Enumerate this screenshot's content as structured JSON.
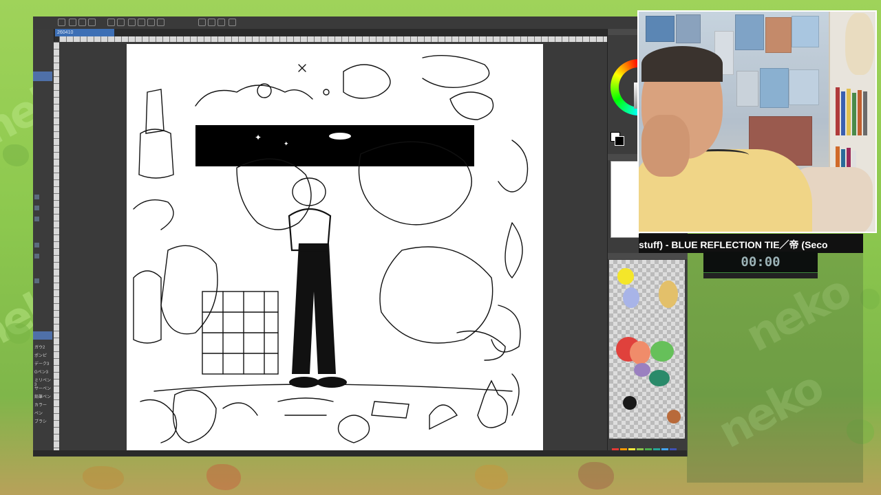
{
  "app": {
    "document_tab": "260410",
    "tool_labels": [
      "ガウ2",
      "ポンピ",
      "デーク3",
      "Gペン3",
      "ミリペン3",
      "サーペン",
      "鉛筆ペン",
      "カラー",
      "ペン",
      "ブラシ"
    ]
  },
  "stream": {
    "song_ticker": "stuff) - BLUE REFLECTION TIE／帝 (Seco",
    "timer": "00:00",
    "timer_progress": 0.0
  },
  "colors": {
    "overlay_green": "#8cc84e",
    "canvas_bg": "#3a3a3a",
    "app_chrome": "#2e2e2e",
    "accent_blue": "#4f70a8"
  },
  "mixer_colors": [
    "#f4e62a",
    "#a8b4e8",
    "#e3c06a",
    "#e0413c",
    "#f08c6a",
    "#66c05a",
    "#2a8a6a",
    "#1a1a1a",
    "#b86a3a",
    "#9a80c0"
  ],
  "palette": [
    "#e53935",
    "#ff9800",
    "#ffeb3b",
    "#8bc34a",
    "#4caf50",
    "#26a69a",
    "#42a5f5",
    "#3f51b5"
  ]
}
